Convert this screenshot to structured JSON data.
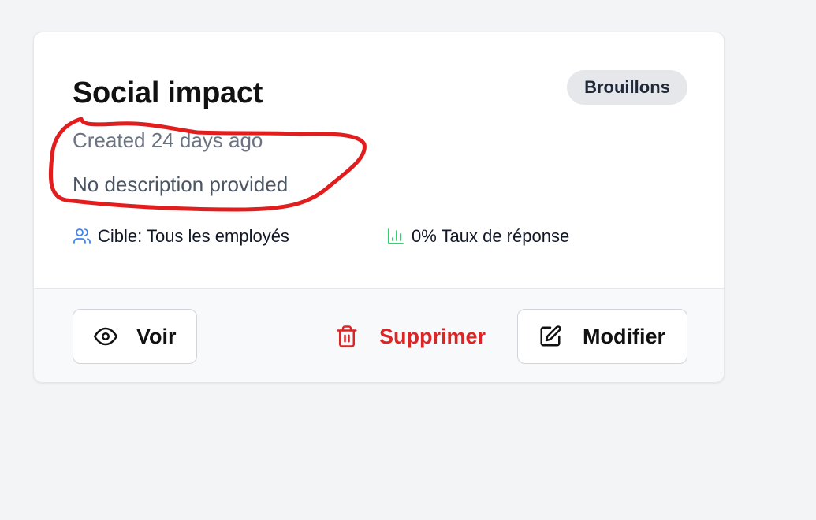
{
  "survey": {
    "title": "Social impact",
    "status_badge": "Brouillons",
    "created": "Created 24 days ago",
    "description": "No description provided",
    "target_label": "Cible: Tous les employés",
    "response_rate_label": "0% Taux de réponse"
  },
  "actions": {
    "view_label": "Voir",
    "delete_label": "Supprimer",
    "edit_label": "Modifier"
  },
  "icons": {
    "target": "users-icon",
    "response_rate": "bar-chart-icon",
    "view": "eye-icon",
    "delete": "trash-icon",
    "edit": "edit-icon"
  },
  "colors": {
    "page_background": "#f3f4f6",
    "card_background": "#ffffff",
    "footer_background": "#f8f9fb",
    "badge_background": "#e5e7eb",
    "delete_red": "#dc2626",
    "users_icon_blue": "#3b82f6",
    "chart_icon_green": "#22c55e",
    "annotation_red": "#e11d1d"
  }
}
